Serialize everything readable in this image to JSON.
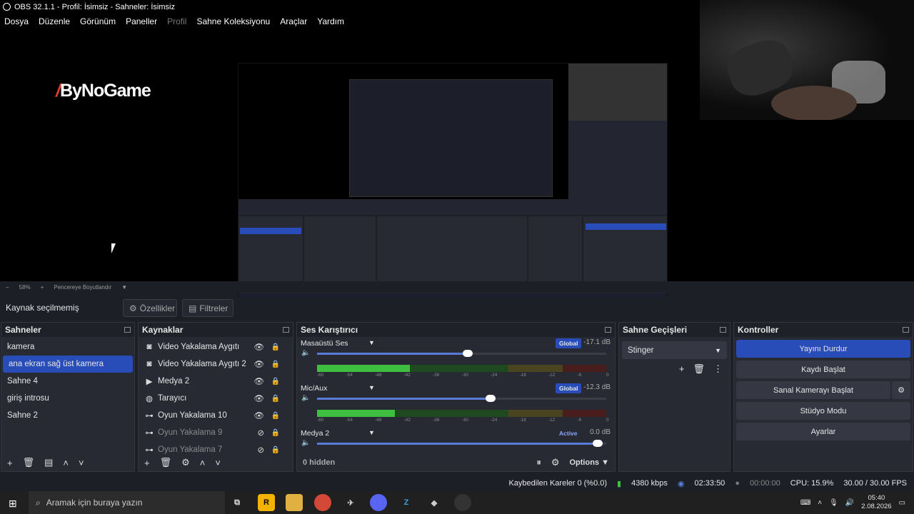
{
  "window": {
    "title": "OBS 32.1.1 - Profil: İsimsiz - Sahneler: İsimsiz"
  },
  "menu": [
    "Dosya",
    "Düzenle",
    "Görünüm",
    "Paneller",
    "Profil",
    "Sahne Koleksiyonu",
    "Araçlar",
    "Yardım"
  ],
  "preview": {
    "logo_text": "ByNoGame",
    "zoom": "58%",
    "zoom_mode": "Pencereye Boyutlandır"
  },
  "source_bar": {
    "selected": "Kaynak seçilmemiş",
    "properties": "Özellikler",
    "filters": "Filtreler"
  },
  "scenes": {
    "title": "Sahneler",
    "items": [
      "kamera",
      "ana ekran sağ üst  kamera",
      "Sahne 4",
      "giriş introsu",
      "Sahne 2"
    ]
  },
  "sources": {
    "title": "Kaynaklar",
    "items": [
      {
        "label": "Video Yakalama Aygıtı",
        "icon": "camera-icon",
        "hidden": false
      },
      {
        "label": "Video Yakalama Aygıtı 2",
        "icon": "camera-icon",
        "hidden": false
      },
      {
        "label": "Medya 2",
        "icon": "play-icon",
        "hidden": false
      },
      {
        "label": "Tarayıcı",
        "icon": "globe-icon",
        "hidden": false
      },
      {
        "label": "Oyun Yakalama 10",
        "icon": "gamepad-icon",
        "hidden": false
      },
      {
        "label": "Oyun Yakalama 9",
        "icon": "gamepad-icon",
        "hidden": true
      },
      {
        "label": "Oyun Yakalama 7",
        "icon": "gamepad-icon",
        "hidden": true
      }
    ]
  },
  "mixer": {
    "title": "Ses Karıştırıcı",
    "channels": [
      {
        "name": "Masaüstü Ses",
        "badge": "Global",
        "db": "-17.1 dB",
        "volume": 0.52,
        "level": 0.32
      },
      {
        "name": "Mic/Aux",
        "badge": "Global",
        "db": "-12.3 dB",
        "volume": 0.6,
        "level": 0.27
      },
      {
        "name": "Medya 2",
        "badge": "Active",
        "db": "0.0 dB",
        "volume": 0.97,
        "level": 0
      }
    ],
    "scale": [
      "-60",
      "-54",
      "-48",
      "-42",
      "-36",
      "-30",
      "-24",
      "-18",
      "-12",
      "-6",
      "0"
    ],
    "hidden": "0 hidden",
    "options": "Options"
  },
  "transitions": {
    "title": "Sahne Geçişleri",
    "selected": "Stinger"
  },
  "controls": {
    "title": "Kontroller",
    "stop_stream": "Yayını Durdur",
    "start_record": "Kaydı Başlat",
    "virtual_cam": "Sanal Kamerayı Başlat",
    "studio_mode": "Stüdyo Modu",
    "settings": "Ayarlar"
  },
  "status": {
    "dropped": "Kaybedilen Kareler 0 (%0.0)",
    "bitrate": "4380 kbps",
    "stream_time": "02:33:50",
    "rec_time": "00:00:00",
    "cpu": "CPU: 15.9%",
    "fps": "30.00 / 30.00 FPS"
  },
  "taskbar": {
    "search": "Aramak için buraya yazın",
    "time": "05:40",
    "date": "2.08.2026"
  }
}
